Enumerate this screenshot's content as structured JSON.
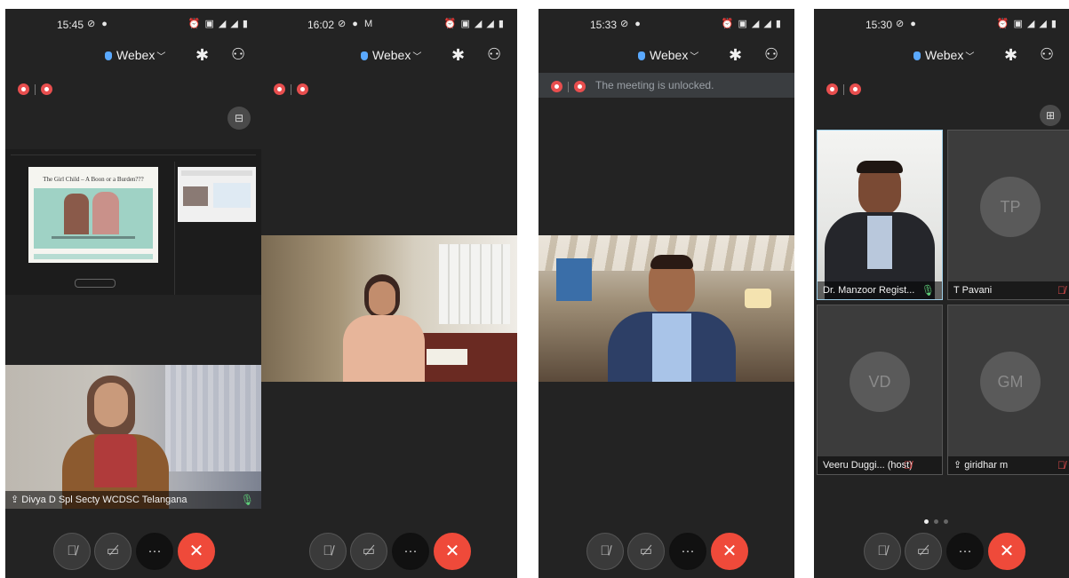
{
  "phones": [
    {
      "time": "15:45",
      "app": "Webex",
      "shared_slide_title": "The Girl Child – A Boon or a Burden???",
      "speaker_name": "Divya D Spl Secty WCDSC Telangana"
    },
    {
      "time": "16:02",
      "app": "Webex"
    },
    {
      "time": "15:33",
      "app": "Webex",
      "banner": "The meeting is unlocked."
    },
    {
      "time": "15:30",
      "app": "Webex",
      "tiles": [
        {
          "name": "Dr. Manzoor Regist...",
          "initials": ""
        },
        {
          "name": "T Pavani",
          "initials": "TP"
        },
        {
          "name": "Veeru Duggi... (host)",
          "initials": "VD"
        },
        {
          "name": "giridhar m",
          "initials": "GM"
        }
      ]
    }
  ],
  "icons": {
    "bluetooth": "bluetooth-icon",
    "participants": "participants-icon",
    "mute": "mic-off-icon",
    "video": "video-off-icon",
    "more": "more-icon",
    "end": "end-call-icon"
  },
  "colors": {
    "end_call": "#ef4a3a",
    "recording": "#e84e4e",
    "webex_shield": "#5aa9ff",
    "background": "#232323"
  }
}
